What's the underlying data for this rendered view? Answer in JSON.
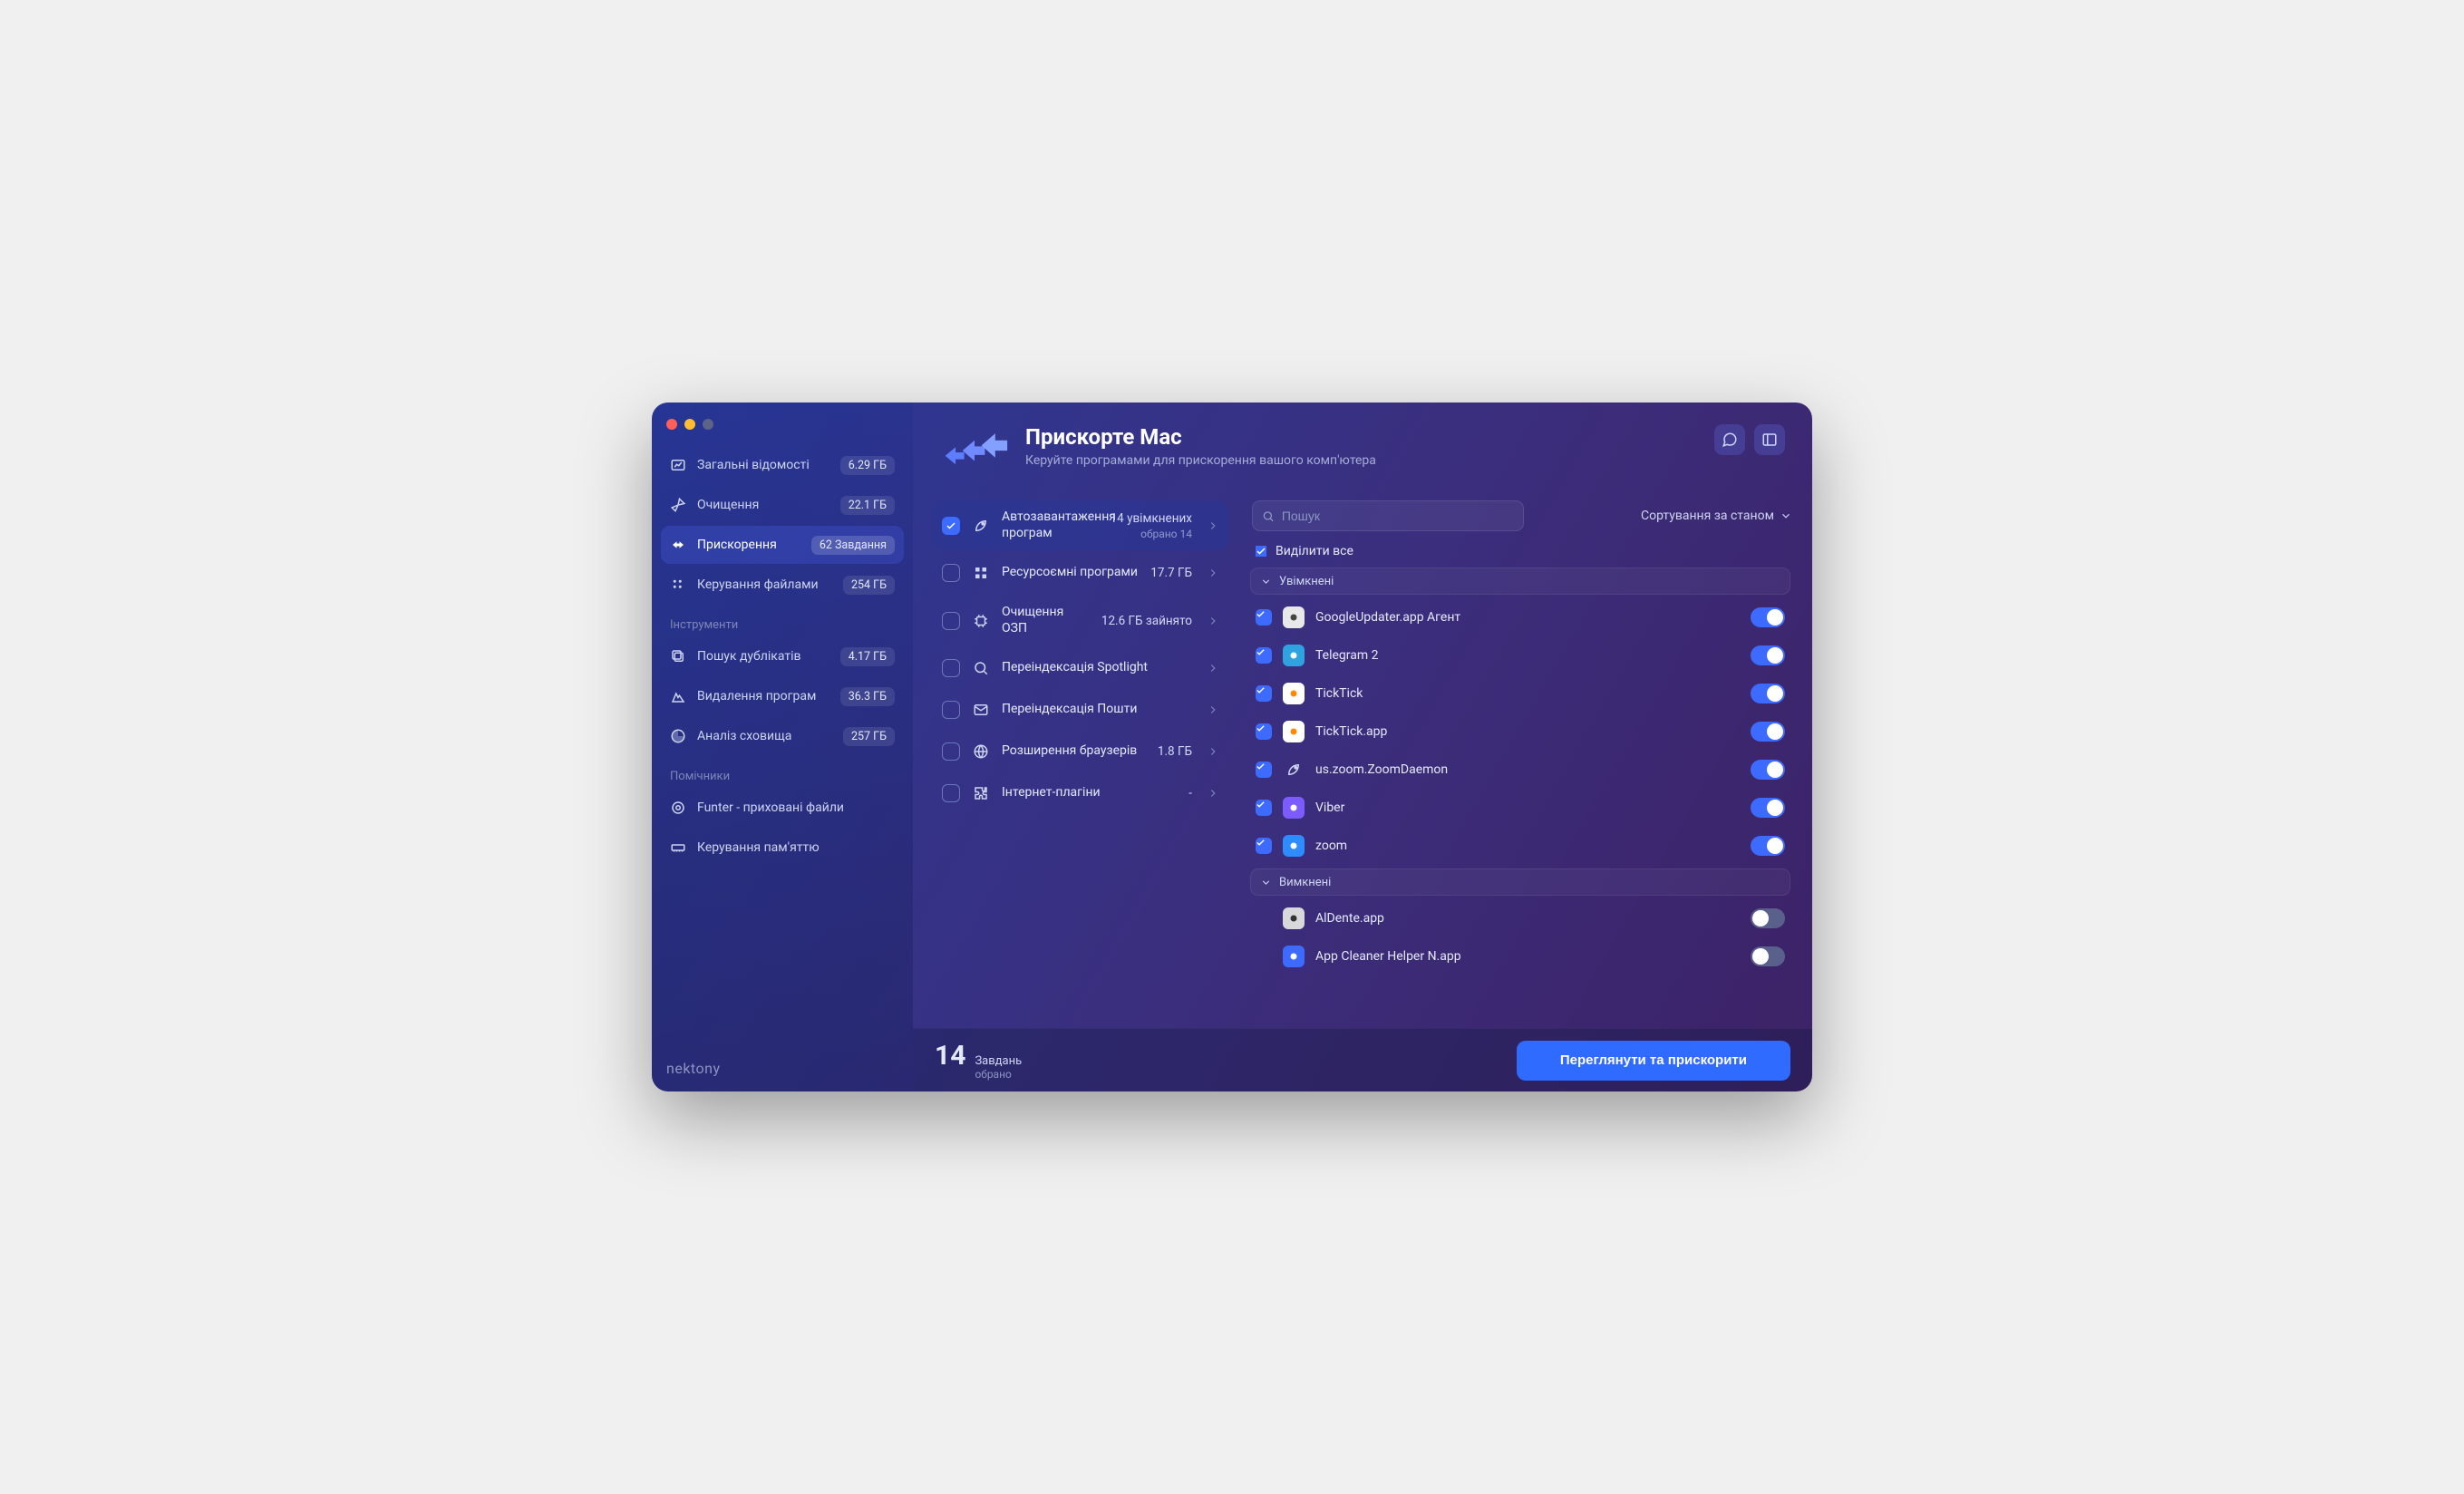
{
  "brand": "nektony",
  "header": {
    "title": "Прискорте Mac",
    "subtitle": "Керуйте програмами для прискорення вашого комп'ютера"
  },
  "sidebar": {
    "main": [
      {
        "icon": "gauge-icon",
        "label": "Загальні відомості",
        "badge": "6.29 ГБ",
        "active": false
      },
      {
        "icon": "broom-icon",
        "label": "Очищення",
        "badge": "22.1 ГБ",
        "active": false
      },
      {
        "icon": "speed-icon",
        "label": "Прискорення",
        "badge": "62 Завдання",
        "active": true
      },
      {
        "icon": "files-icon",
        "label": "Керування файлами",
        "badge": "254 ГБ",
        "active": false
      }
    ],
    "tools_heading": "Інструменти",
    "tools": [
      {
        "icon": "dup-icon",
        "label": "Пошук дублікатів",
        "badge": "4.17 ГБ"
      },
      {
        "icon": "uninst-icon",
        "label": "Видалення програм",
        "badge": "36.3 ГБ"
      },
      {
        "icon": "disk-icon",
        "label": "Аналіз сховища",
        "badge": "257 ГБ"
      }
    ],
    "helpers_heading": "Помічники",
    "helpers": [
      {
        "icon": "target-icon",
        "label": "Funter - приховані файли",
        "badge": ""
      },
      {
        "icon": "ram-icon",
        "label": "Керування пам'яттю",
        "badge": ""
      }
    ]
  },
  "categories": [
    {
      "checked": true,
      "icon": "rocket-icon",
      "title": "Автозавантаження програм",
      "value": "14 увімкнених",
      "sub": "обрано 14",
      "active": true
    },
    {
      "checked": false,
      "icon": "grid-icon",
      "title": "Ресурсоємні програми",
      "value": "17.7 ГБ",
      "sub": ""
    },
    {
      "checked": false,
      "icon": "chip-icon",
      "title": "Очищення ОЗП",
      "value": "12.6 ГБ зайнято",
      "sub": ""
    },
    {
      "checked": false,
      "icon": "search-icon",
      "title": "Переіндексація Spotlight",
      "value": "",
      "sub": ""
    },
    {
      "checked": false,
      "icon": "mail-icon",
      "title": "Переіндексація Пошти",
      "value": "",
      "sub": ""
    },
    {
      "checked": false,
      "icon": "globe-icon",
      "title": "Розширення браузерів",
      "value": "1.8 ГБ",
      "sub": ""
    },
    {
      "checked": false,
      "icon": "puzzle-icon",
      "title": "Інтернет-плагіни",
      "value": "-",
      "sub": ""
    }
  ],
  "apps_panel": {
    "search_placeholder": "Пошук",
    "sort_label": "Сортування за станом",
    "select_all_label": "Виділити все",
    "group_enabled": "Увімкнені",
    "group_disabled": "Вимкнені",
    "enabled": [
      {
        "checked": true,
        "name": "GoogleUpdater.app Агент",
        "icon_bg": "#e8e8ea",
        "icon_fg": "#444"
      },
      {
        "checked": true,
        "name": "Telegram 2",
        "icon_bg": "#2fa3e0",
        "icon_fg": "#fff"
      },
      {
        "checked": true,
        "name": "TickTick",
        "icon_bg": "#ffffff",
        "icon_fg": "#ff8a00"
      },
      {
        "checked": true,
        "name": "TickTick.app",
        "icon_bg": "#ffffff",
        "icon_fg": "#ff8a00"
      },
      {
        "checked": true,
        "name": "us.zoom.ZoomDaemon",
        "icon_bg": "transparent",
        "icon_fg": "#cfd5f4"
      },
      {
        "checked": true,
        "name": "Viber",
        "icon_bg": "#7d5cff",
        "icon_fg": "#fff"
      },
      {
        "checked": true,
        "name": "zoom",
        "icon_bg": "#2d8cff",
        "icon_fg": "#fff"
      }
    ],
    "disabled": [
      {
        "checked": false,
        "name": "AlDente.app",
        "icon_bg": "#d8d8da",
        "icon_fg": "#333"
      },
      {
        "checked": false,
        "name": "App Cleaner Helper N.app",
        "icon_bg": "#3d6bff",
        "icon_fg": "#fff"
      }
    ]
  },
  "footer": {
    "count": "14",
    "count_label": "Завдань",
    "count_sub": "обрано",
    "cta": "Переглянути та прискорити"
  }
}
